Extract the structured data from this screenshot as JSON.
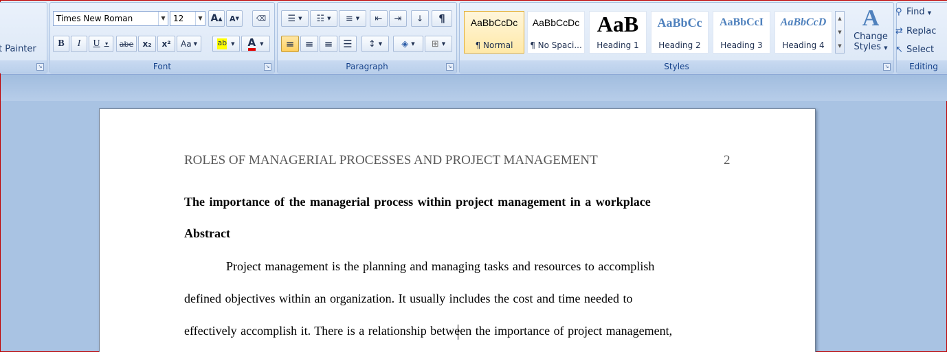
{
  "clipboard": {
    "format_painter_label": "t Painter"
  },
  "font": {
    "group_label": "Font",
    "face": "Times New Roman",
    "size": "12",
    "grow": "A",
    "shrink": "A",
    "bold": "B",
    "italic": "I",
    "underline": "U",
    "strike": "abe",
    "subscript": "x₂",
    "superscript": "x²",
    "change_case": "Aa",
    "highlight": "ab",
    "font_color": "A"
  },
  "paragraph": {
    "group_label": "Paragraph",
    "show_marks": "¶"
  },
  "styles": {
    "group_label": "Styles",
    "items": [
      {
        "sample": "AaBbCcDc",
        "name": "¶ Normal"
      },
      {
        "sample": "AaBbCcDc",
        "name": "¶ No Spaci..."
      },
      {
        "sample": "AaB",
        "name": "Heading 1"
      },
      {
        "sample": "AaBbCc",
        "name": "Heading 2"
      },
      {
        "sample": "AaBbCcI",
        "name": "Heading 3"
      },
      {
        "sample": "AaBbCcD",
        "name": "Heading 4"
      }
    ],
    "change_styles_line1": "Change",
    "change_styles_line2": "Styles",
    "change_styles_icon": "A"
  },
  "editing": {
    "group_label": "Editing",
    "find": "Find",
    "replace": "Replac",
    "select": "Select"
  },
  "document": {
    "running_head": "ROLES OF MANAGERIAL PROCESSES AND PROJECT MANAGEMENT",
    "page_number": "2",
    "title": "The importance of the managerial process within project management in a workplace",
    "abstract_heading": "Abstract",
    "lines": [
      "Project management is the planning and managing tasks and resources to accomplish",
      "defined objectives within an organization. It usually includes the cost and time needed to",
      "effectively accomplish it. There is a relationship between the importance of project management,"
    ]
  }
}
